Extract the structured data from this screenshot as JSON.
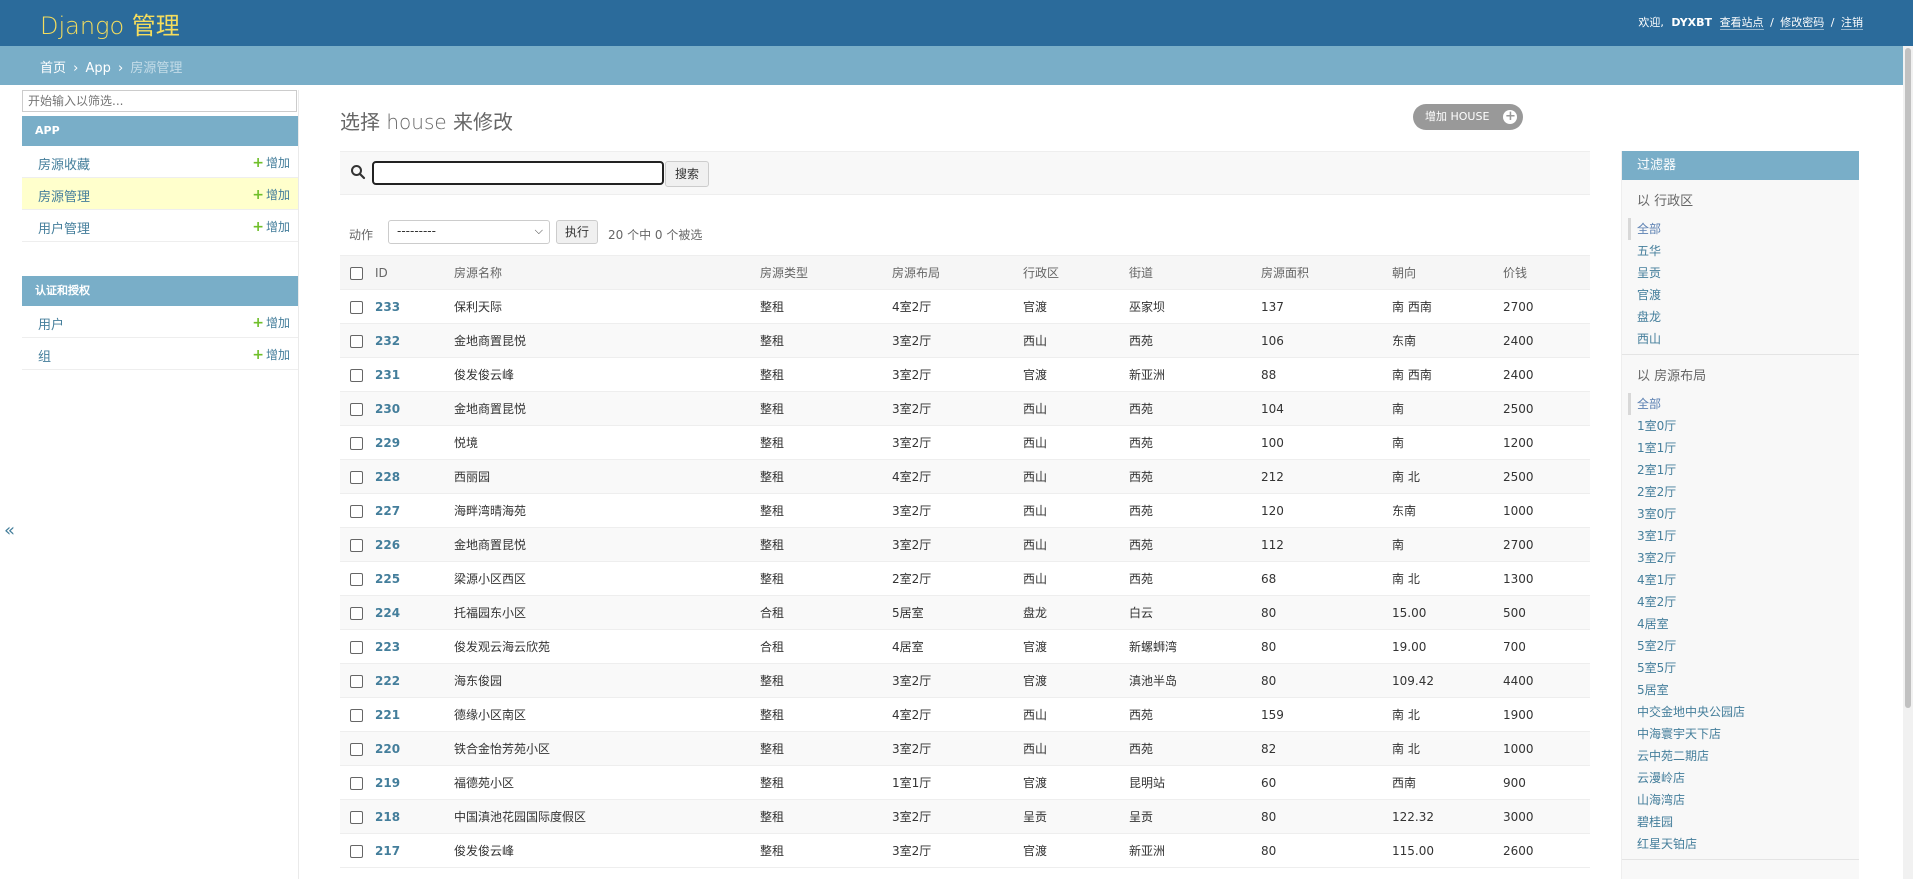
{
  "header": {
    "site_name": "Django 管理",
    "welcome": "欢迎,",
    "username": "DYXBT",
    "view_site": "查看站点",
    "change_password": "修改密码",
    "logout": "注销",
    "sep": "/"
  },
  "breadcrumbs": {
    "home": "首页",
    "app": "App",
    "current": "房源管理",
    "sep": "›"
  },
  "sidebar": {
    "filter_placeholder": "开始输入以筛选...",
    "toggle_icon": "«",
    "add_label": "增加",
    "modules": [
      {
        "caption": "APP",
        "items": [
          {
            "name": "房源收藏"
          },
          {
            "name": "房源管理"
          },
          {
            "name": "用户管理"
          }
        ]
      },
      {
        "caption": "认证和授权",
        "items": [
          {
            "name": "用户"
          },
          {
            "name": "组"
          }
        ]
      }
    ]
  },
  "content": {
    "title": "选择 house 来修改",
    "add_button": "增加 HOUSE",
    "search_button": "搜索",
    "action_label": "动作",
    "action_selected": "---------",
    "run_button": "执行",
    "counter": "20 个中 0 个被选"
  },
  "table": {
    "columns": [
      "ID",
      "房源名称",
      "房源类型",
      "房源布局",
      "行政区",
      "街道",
      "房源面积",
      "朝向",
      "价钱"
    ],
    "rows": [
      [
        "233",
        "保利天际",
        "整租",
        "4室2厅",
        "官渡",
        "巫家坝",
        "137",
        "南 西南",
        "2700"
      ],
      [
        "232",
        "金地商置昆悦",
        "整租",
        "3室2厅",
        "西山",
        "西苑",
        "106",
        "东南",
        "2400"
      ],
      [
        "231",
        "俊发俊云峰",
        "整租",
        "3室2厅",
        "官渡",
        "新亚洲",
        "88",
        "南 西南",
        "2400"
      ],
      [
        "230",
        "金地商置昆悦",
        "整租",
        "3室2厅",
        "西山",
        "西苑",
        "104",
        "南",
        "2500"
      ],
      [
        "229",
        "悦境",
        "整租",
        "3室2厅",
        "西山",
        "西苑",
        "100",
        "南",
        "1200"
      ],
      [
        "228",
        "西丽园",
        "整租",
        "4室2厅",
        "西山",
        "西苑",
        "212",
        "南 北",
        "2500"
      ],
      [
        "227",
        "海畔湾晴海苑",
        "整租",
        "3室2厅",
        "西山",
        "西苑",
        "120",
        "东南",
        "1000"
      ],
      [
        "226",
        "金地商置昆悦",
        "整租",
        "3室2厅",
        "西山",
        "西苑",
        "112",
        "南",
        "2700"
      ],
      [
        "225",
        "梁源小区西区",
        "整租",
        "2室2厅",
        "西山",
        "西苑",
        "68",
        "南 北",
        "1300"
      ],
      [
        "224",
        "托福园东小区",
        "合租",
        "5居室",
        "盘龙",
        "白云",
        "80",
        "15.00",
        "500"
      ],
      [
        "223",
        "俊发观云海云欣苑",
        "合租",
        "4居室",
        "官渡",
        "新螺蛳湾",
        "80",
        "19.00",
        "700"
      ],
      [
        "222",
        "海东俊园",
        "整租",
        "3室2厅",
        "官渡",
        "滇池半岛",
        "80",
        "109.42",
        "4400"
      ],
      [
        "221",
        "德缘小区南区",
        "整租",
        "4室2厅",
        "西山",
        "西苑",
        "159",
        "南 北",
        "1900"
      ],
      [
        "220",
        "铁合金怡芳苑小区",
        "整租",
        "3室2厅",
        "西山",
        "西苑",
        "82",
        "南 北",
        "1000"
      ],
      [
        "219",
        "福德苑小区",
        "整租",
        "1室1厅",
        "官渡",
        "昆明站",
        "60",
        "西南",
        "900"
      ],
      [
        "218",
        "中国滇池花园国际度假区",
        "整租",
        "3室2厅",
        "呈贡",
        "呈贡",
        "80",
        "122.32",
        "3000"
      ],
      [
        "217",
        "俊发俊云峰",
        "整租",
        "3室2厅",
        "官渡",
        "新亚洲",
        "80",
        "115.00",
        "2600"
      ]
    ]
  },
  "filter": {
    "title": "过滤器",
    "groups": [
      {
        "heading": "以 行政区",
        "items": [
          "全部",
          "五华",
          "呈贡",
          "官渡",
          "盘龙",
          "西山"
        ]
      },
      {
        "heading": "以 房源布局",
        "items": [
          "全部",
          "1室0厅",
          "1室1厅",
          "2室1厅",
          "2室2厅",
          "3室0厅",
          "3室1厅",
          "3室2厅",
          "4室1厅",
          "4室2厅",
          "4居室",
          "5室2厅",
          "5室5厅",
          "5居室",
          "中交金地中央公园店",
          "中海寰宇天下店",
          "云中苑二期店",
          "云漫岭店",
          "山海湾店",
          "碧桂园",
          "红星天铂店"
        ]
      }
    ]
  },
  "colors": {
    "header_bg": "#2b6b9b",
    "site_name": "#f5dd5d",
    "breadcrumb_bg": "#79aec8",
    "link": "#447e9b",
    "add_green": "#70bf2b",
    "current_row": "#ffffcc"
  }
}
